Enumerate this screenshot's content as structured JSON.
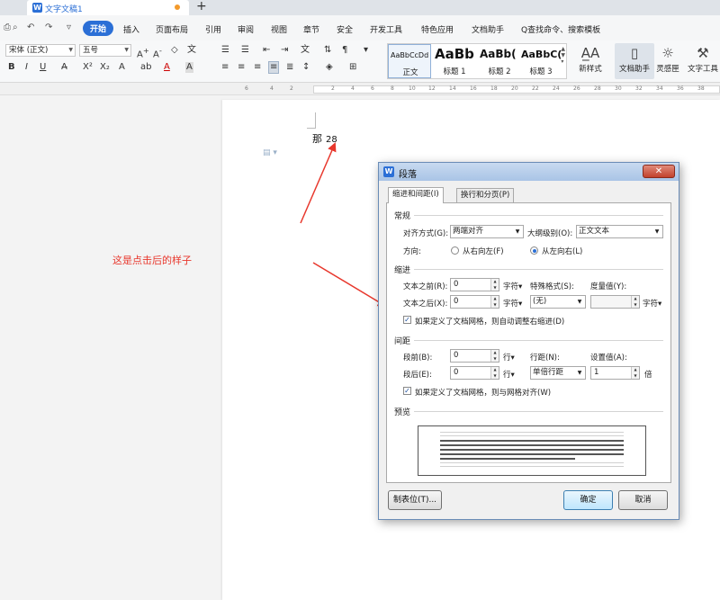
{
  "titlebar": {
    "doc_title": "文字文稿1",
    "doc_icon": "W",
    "new_tab_symbol": "+"
  },
  "menu": {
    "items": [
      "开始",
      "插入",
      "页面布局",
      "引用",
      "审阅",
      "视图",
      "章节",
      "安全",
      "开发工具",
      "特色应用",
      "文档助手"
    ],
    "active": "开始",
    "search": "Q查找命令、搜索模板"
  },
  "ribbon": {
    "font_name": "宋体 (正文)",
    "font_size": "五号",
    "styles": [
      {
        "sample": "AaBbCcDd",
        "name": "正文"
      },
      {
        "sample": "AaBb",
        "name": "标题 1"
      },
      {
        "sample": "AaBb(",
        "name": "标题 2"
      },
      {
        "sample": "AaBbC(",
        "name": "标题 3"
      }
    ],
    "new_style": "新样式",
    "doc_assistant": "文档助手",
    "inspiration": "灵感匣",
    "text_tools": "文字工具"
  },
  "ruler_ticks": [
    "6",
    "4",
    "2",
    "2",
    "4",
    "6",
    "8",
    "10",
    "12",
    "14",
    "16",
    "18",
    "20",
    "22",
    "24",
    "26",
    "28",
    "30",
    "32",
    "34",
    "36",
    "38"
  ],
  "document": {
    "text": "那",
    "number": "28",
    "annotation": "这是点击后的样子"
  },
  "dialog": {
    "title": "段落",
    "tabs": [
      "缩进和间距(I)",
      "换行和分页(P)"
    ],
    "general": {
      "heading": "常规",
      "alignment_label": "对齐方式(G):",
      "alignment_value": "两端对齐",
      "outline_label": "大纲级别(O):",
      "outline_value": "正文文本",
      "direction_label": "方向:",
      "rtl_label": "从右向左(F)",
      "ltr_label": "从左向右(L)"
    },
    "indent": {
      "heading": "缩进",
      "before_label": "文本之前(R):",
      "before_value": "0",
      "after_label": "文本之后(X):",
      "after_value": "0",
      "unit": "字符▾",
      "special_label": "特殊格式(S):",
      "special_value": "(无)",
      "measure_label": "度量值(Y):",
      "measure_value": "",
      "auto_adjust_label": "如果定义了文档网格，则自动调整右缩进(D)"
    },
    "spacing": {
      "heading": "间距",
      "before_label": "段前(B):",
      "before_value": "0",
      "after_label": "段后(E):",
      "after_value": "0",
      "unit": "行▾",
      "line_label": "行距(N):",
      "line_value": "单倍行距",
      "setting_label": "设置值(A):",
      "setting_value": "1",
      "setting_unit": "倍",
      "grid_label": "如果定义了文档网格，则与网格对齐(W)"
    },
    "preview": {
      "heading": "预览"
    },
    "buttons": {
      "tabs": "制表位(T)...",
      "ok": "确定",
      "cancel": "取消"
    }
  },
  "colors": {
    "accent": "#2b6fd6",
    "annotation": "#e8372c"
  }
}
